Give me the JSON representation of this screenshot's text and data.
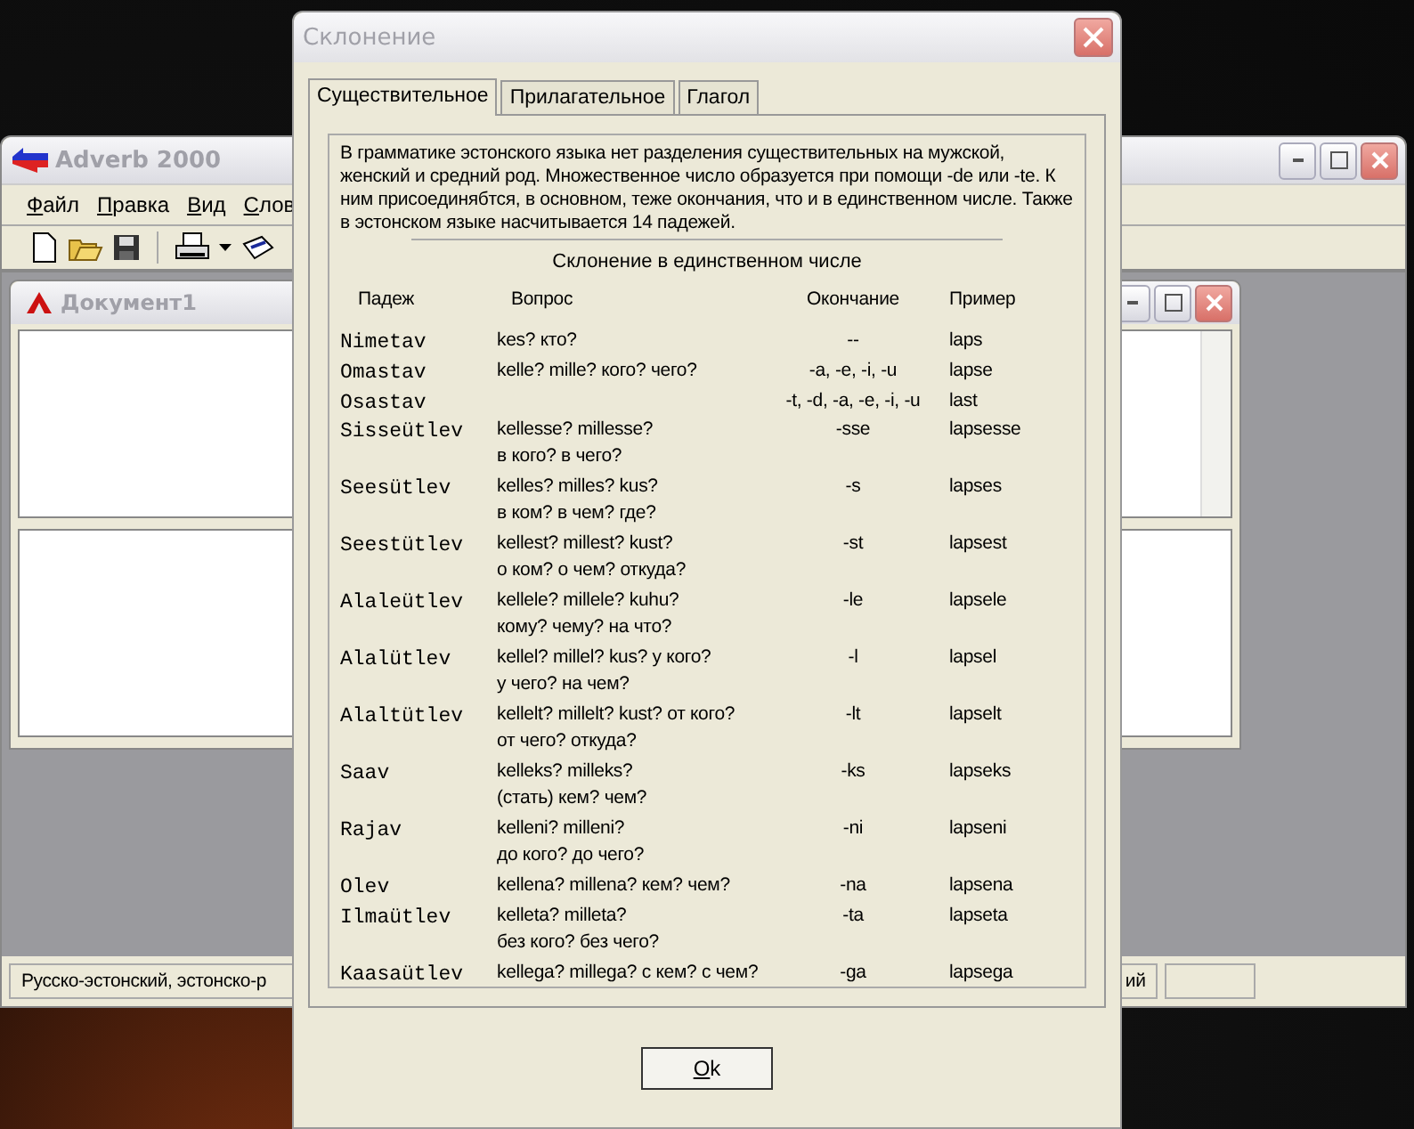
{
  "main_window": {
    "title": "Adverb 2000",
    "menu": [
      "Файл",
      "Правка",
      "Вид",
      "Слов"
    ],
    "document": {
      "title": "Документ1"
    },
    "status_bar": [
      "Русско-эстонский, эстонско-р",
      "ий"
    ]
  },
  "dialog": {
    "title": "Склонение",
    "tabs": [
      {
        "label": "Существительное",
        "selected": true
      },
      {
        "label": "Прилагательное",
        "selected": false
      },
      {
        "label": "Глагол",
        "selected": false
      }
    ],
    "intro": "В грамматике эстонского языка нет разделения существительных на мужской, женский и средний род. Множественное число образуется при помощи -de или -te. К ним присоединябтся, в основном, теже окончания, что и в единственном числе. Также в эстонском языке насчитывается 14 падежей.",
    "table_title": "Склонение в единственном числе",
    "columns": [
      "Падеж",
      "Вопрос",
      "Окончание",
      "Пример"
    ],
    "rows": [
      {
        "case": "Nimetav",
        "question": [
          "kes? кто?"
        ],
        "ending": "--",
        "example": "laps"
      },
      {
        "case": "Omastav",
        "question": [
          "kelle? mille? кого? чего?"
        ],
        "ending": "-a, -e, -i, -u",
        "example": "lapse"
      },
      {
        "case": "Osastav",
        "ending": "-t, -d, -a, -e, -i, -u",
        "example": "last"
      },
      {
        "case": "Sisseütlev",
        "question": [
          "kellesse? millesse?",
          "в кого? в чего?"
        ],
        "ending": "-sse",
        "example": "lapsesse"
      },
      {
        "case": "Seesütlev",
        "question": [
          "kelles? milles? kus?",
          "в ком? в чем? где?"
        ],
        "ending": "-s",
        "example": "lapses"
      },
      {
        "case": "Seestütlev",
        "question": [
          "kellest? millest? kust?",
          "о ком? о чем? откуда?"
        ],
        "ending": "-st",
        "example": "lapsest"
      },
      {
        "case": "Alaleütlev",
        "question": [
          "kellele? millele? kuhu?",
          "кому? чему? на что?"
        ],
        "ending": "-le",
        "example": "lapsele"
      },
      {
        "case": "Alalütlev",
        "question": [
          "kellel? millel? kus? у кого?",
          "у чего? на чем?"
        ],
        "ending": "-l",
        "example": "lapsel"
      },
      {
        "case": "Alaltütlev",
        "question": [
          "kellelt? millelt? kust? от кого?",
          "от чего? откуда?"
        ],
        "ending": "-lt",
        "example": "lapselt"
      },
      {
        "case": "Saav",
        "question": [
          "kelleks? milleks?",
          "(стать) кем? чем?"
        ],
        "ending": "-ks",
        "example": "lapseks"
      },
      {
        "case": "Rajav",
        "question": [
          "kelleni? milleni?",
          "до кого? до чего?"
        ],
        "ending": "-ni",
        "example": "lapseni"
      },
      {
        "case": "Olev",
        "question": [
          "kellena? millena? кем? чем?"
        ],
        "ending": "-na",
        "example": "lapsena"
      },
      {
        "case": "Ilmaütlev",
        "question": [
          "kelleta? milleta?",
          "без кого? без чего?"
        ],
        "ending": "-ta",
        "example": "lapseta"
      },
      {
        "case": "Kaasaütlev",
        "question": [
          "kellega? millega? с кем? с чем?"
        ],
        "ending": "-ga",
        "example": "lapsega"
      }
    ],
    "button": "Ok"
  }
}
